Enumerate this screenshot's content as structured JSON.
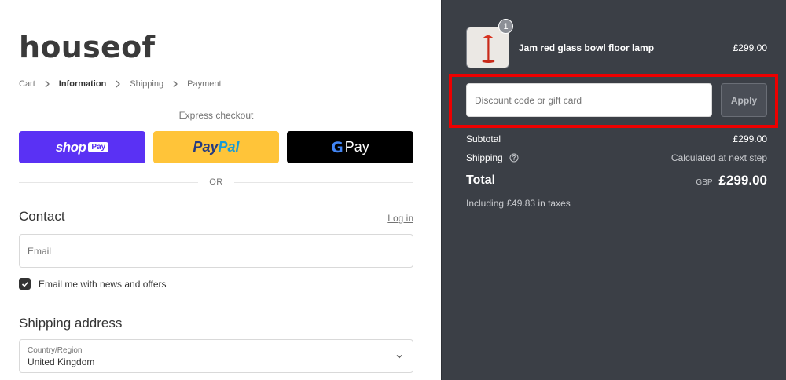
{
  "brand": {
    "logo": "houseof"
  },
  "breadcrumb": [
    {
      "label": "Cart"
    },
    {
      "label": "Information"
    },
    {
      "label": "Shipping"
    },
    {
      "label": "Payment"
    }
  ],
  "express": {
    "title": "Express checkout",
    "shop_pay": {
      "word": "shop",
      "badge": "Pay"
    },
    "paypal": {
      "pay": "Pay",
      "pal": "Pal"
    },
    "gpay": {
      "g": "G",
      "pay": "Pay"
    },
    "or_text": "OR"
  },
  "contact": {
    "title": "Contact",
    "login_link": "Log in",
    "email_placeholder": "Email",
    "newsletter_label": "Email me with news and offers",
    "newsletter_checked": true
  },
  "shipping_address": {
    "title": "Shipping address",
    "country_label": "Country/Region",
    "country_value": "United Kingdom"
  },
  "order": {
    "item": {
      "quantity": "1",
      "name": "Jam red glass bowl floor lamp",
      "price": "£299.00"
    },
    "discount": {
      "placeholder": "Discount code or gift card",
      "apply_label": "Apply"
    },
    "subtotal_label": "Subtotal",
    "subtotal_value": "£299.00",
    "shipping_label": "Shipping",
    "shipping_value": "Calculated at next step",
    "total_label": "Total",
    "currency": "GBP",
    "total_value": "£299.00",
    "taxes_note": "Including £49.83 in taxes"
  },
  "colors": {
    "sidebar_bg": "#3b3f46",
    "shop_pay": "#5a31f4",
    "paypal": "#ffc439",
    "highlight": "#ee0000"
  }
}
